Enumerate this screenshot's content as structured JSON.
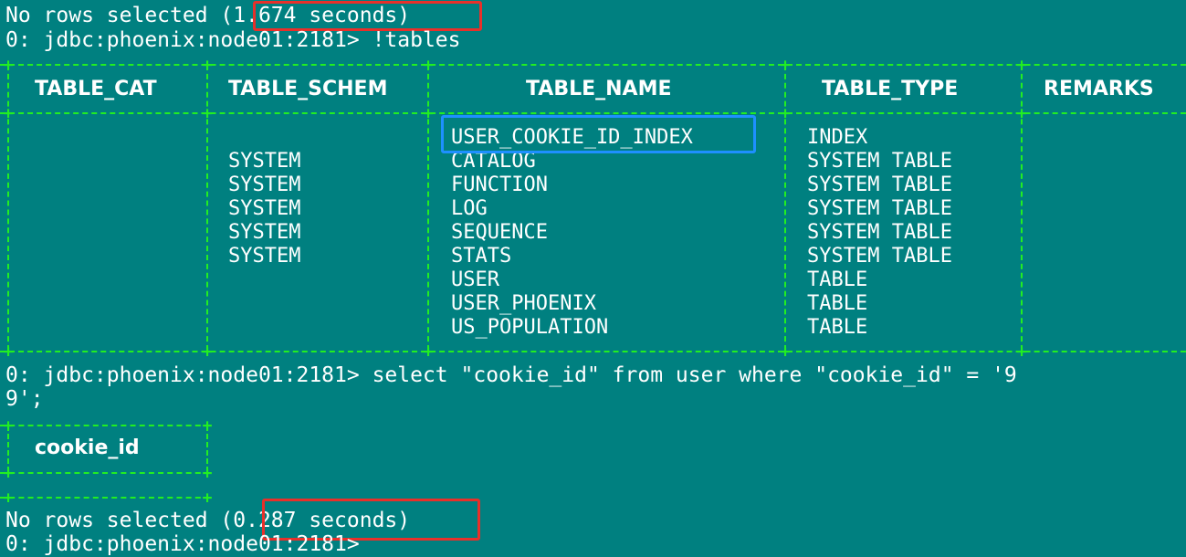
{
  "terminal": {
    "line1_prefix": "No rows selected ",
    "line1_time": "(1.674 seconds)",
    "prompt_tables": "0: jdbc:phoenix:node01:2181> !tables",
    "tables_result": {
      "columns": [
        "TABLE_CAT",
        "TABLE_SCHEM",
        "TABLE_NAME",
        "TABLE_TYPE",
        "REMARKS"
      ],
      "rows": [
        {
          "cat": "",
          "schem": "",
          "name": "USER_COOKIE_ID_INDEX",
          "type": "INDEX",
          "remarks": ""
        },
        {
          "cat": "",
          "schem": "SYSTEM",
          "name": "CATALOG",
          "type": "SYSTEM TABLE",
          "remarks": ""
        },
        {
          "cat": "",
          "schem": "SYSTEM",
          "name": "FUNCTION",
          "type": "SYSTEM TABLE",
          "remarks": ""
        },
        {
          "cat": "",
          "schem": "SYSTEM",
          "name": "LOG",
          "type": "SYSTEM TABLE",
          "remarks": ""
        },
        {
          "cat": "",
          "schem": "SYSTEM",
          "name": "SEQUENCE",
          "type": "SYSTEM TABLE",
          "remarks": ""
        },
        {
          "cat": "",
          "schem": "SYSTEM",
          "name": "STATS",
          "type": "SYSTEM TABLE",
          "remarks": ""
        },
        {
          "cat": "",
          "schem": "",
          "name": "USER",
          "type": "TABLE",
          "remarks": ""
        },
        {
          "cat": "",
          "schem": "",
          "name": "USER_PHOENIX",
          "type": "TABLE",
          "remarks": ""
        },
        {
          "cat": "",
          "schem": "",
          "name": "US_POPULATION",
          "type": "TABLE",
          "remarks": ""
        }
      ]
    },
    "prompt_select_line1": "0: jdbc:phoenix:node01:2181> select \"cookie_id\" from user where \"cookie_id\" = '9",
    "prompt_select_line2": "9';",
    "select_result": {
      "columns": [
        "cookie_id"
      ]
    },
    "line_end_prefix": "No rows selected ",
    "line_end_time": "(0.287 seconds)",
    "prompt_final": "0: jdbc:phoenix:node01:2181>"
  },
  "colors": {
    "background": "#008080",
    "text": "#ffffff",
    "table_border": "#22ee22",
    "highlight_red": "#e8302a",
    "highlight_blue": "#1e90ff"
  }
}
